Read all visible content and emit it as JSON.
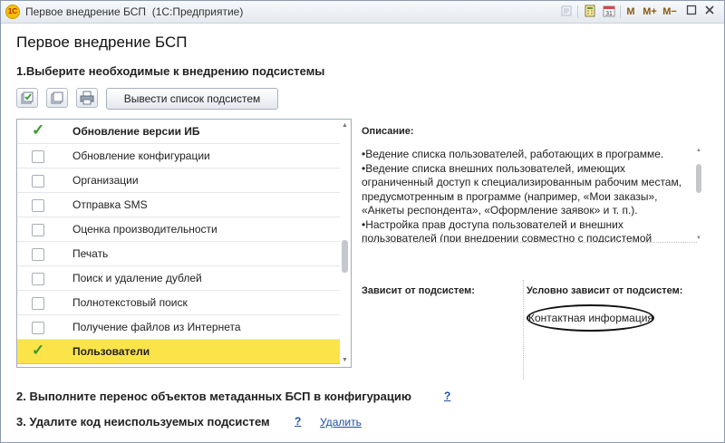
{
  "window": {
    "title": "Первое внедрение БСП",
    "app_name": "(1С:Предприятие)",
    "app_icon_text": "1С",
    "toolbar": {
      "m_label": "M",
      "m_plus_label": "M+",
      "m_minus_label": "M−"
    }
  },
  "page": {
    "heading": "Первое внедрение БСП",
    "step1_title": "1.Выберите необходимые к внедрению подсистемы",
    "list_button_label": "Вывести список подсистем",
    "step2_title": "2. Выполните перенос объектов метаданных БСП в конфигурацию",
    "step2_help": "?",
    "step3_title": "3. Удалите код неиспользуемых подсистем",
    "step3_help": "?",
    "step3_link": "Удалить"
  },
  "subsystems": [
    {
      "label": "Обновление версии ИБ",
      "checked": true,
      "bold": true,
      "selected": false
    },
    {
      "label": "Обновление конфигурации",
      "checked": false,
      "bold": false,
      "selected": false
    },
    {
      "label": "Организации",
      "checked": false,
      "bold": false,
      "selected": false
    },
    {
      "label": "Отправка SMS",
      "checked": false,
      "bold": false,
      "selected": false
    },
    {
      "label": "Оценка производительности",
      "checked": false,
      "bold": false,
      "selected": false
    },
    {
      "label": "Печать",
      "checked": false,
      "bold": false,
      "selected": false
    },
    {
      "label": "Поиск и удаление дублей",
      "checked": false,
      "bold": false,
      "selected": false
    },
    {
      "label": "Полнотекстовый поиск",
      "checked": false,
      "bold": false,
      "selected": false
    },
    {
      "label": "Получение файлов из Интернета",
      "checked": false,
      "bold": false,
      "selected": false
    },
    {
      "label": "Пользователи",
      "checked": true,
      "bold": true,
      "selected": true
    }
  ],
  "description": {
    "label": "Описание:",
    "lines": [
      "•Ведение списка пользователей, работающих в программе.",
      "•Ведение списка внешних пользователей, имеющих",
      "ограниченный доступ к специализированным рабочим местам,",
      "предусмотренным в программе (например, «Мои заказы»,",
      "«Анкеты респондента», «Оформление заявок» и т. п.).",
      "•Настройка прав доступа пользователей и внешних",
      "пользователей (при внедрении совместно с подсистемой"
    ]
  },
  "dependencies": {
    "depends_on_label": "Зависит от подсистем:",
    "conditional_label": "Условно зависит от подсистем:",
    "conditional_items": [
      "Контактная информация"
    ]
  },
  "colors": {
    "selected_row": "#fbe34a",
    "check_green": "#3a9a2c",
    "link_blue": "#1c4fa8",
    "titlebar": "#e8edf2"
  }
}
